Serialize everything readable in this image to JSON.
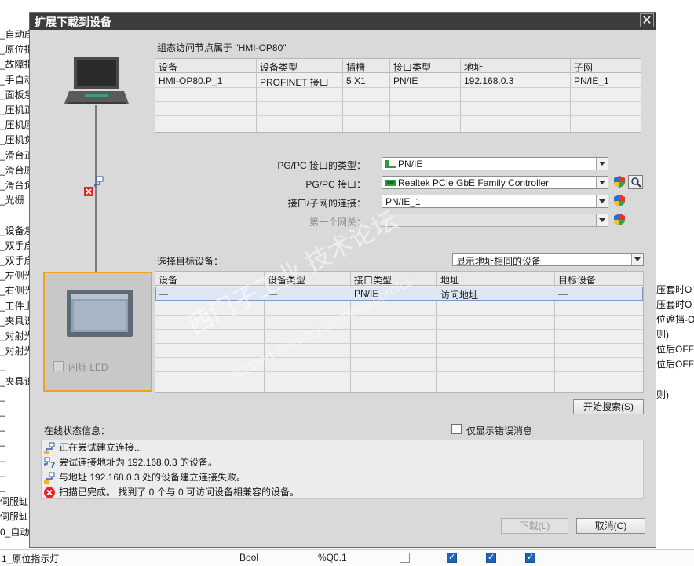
{
  "background": {
    "left_items": [
      "_自动启",
      "_原位指",
      "_故障指",
      "_手自动",
      "_面板急",
      "_压机正",
      "_压机原",
      "_压机负",
      "_滑台正",
      "_滑台原",
      "_滑台负",
      "_光栅",
      "",
      "_设备急",
      "_双手启",
      "_双手启",
      "_左侧光",
      "_右侧光",
      "_工件上",
      "_夹具识",
      "_对射光",
      "_对射光",
      "_",
      "_夹具识",
      "_",
      "_",
      "_",
      "_",
      "_",
      "_",
      "_",
      "伺服缸",
      "伺服缸",
      "0_自动"
    ],
    "right_items": [
      "压套时O",
      "压套时O",
      "位遮挡-O",
      "则)",
      "位后OFF",
      "位后OFF",
      "则)"
    ],
    "bottom_row": {
      "name": "1_原位指示灯",
      "type": "Bool",
      "address": "%Q0.1",
      "checks": [
        false,
        true,
        true,
        true
      ]
    }
  },
  "dialog": {
    "title": "扩展下载到设备",
    "close_glyph": "✕",
    "node_caption": "组态访问节点属于 \"HMI-OP80\"",
    "node_table": {
      "headers": [
        "设备",
        "设备类型",
        "插槽",
        "接口类型",
        "地址",
        "子网"
      ],
      "rows": [
        [
          "HMI-OP80.P_1",
          "PROFINET 接口",
          "5 X1",
          "PN/IE",
          "192.168.0.3",
          "PN/IE_1"
        ]
      ]
    },
    "pgpc_type": {
      "label": "PG/PC 接口的类型：",
      "value": "PN/IE"
    },
    "pgpc_iface": {
      "label": "PG/PC 接口：",
      "value": "Realtek PCIe GbE Family Controller"
    },
    "subnet_conn": {
      "label": "接口/子网的连接：",
      "value": "PN/IE_1"
    },
    "first_gateway": {
      "label": "第一个网关：",
      "value": ""
    },
    "target_label": "选择目标设备：",
    "target_filter": "显示地址相同的设备",
    "target_table": {
      "headers": [
        "设备",
        "设备类型",
        "接口类型",
        "地址",
        "目标设备"
      ],
      "rows": [
        [
          "—",
          "—",
          "PN/IE",
          "访问地址",
          "—"
        ]
      ]
    },
    "flash_led_label": "闪烁 LED",
    "start_search": "开始搜索(S)",
    "status_label": "在线状态信息：",
    "errors_only_label": "仅显示错误消息",
    "status_messages": [
      {
        "icon": "connection-icon",
        "text": "正在尝试建立连接..."
      },
      {
        "icon": "connection-question-icon",
        "text": "尝试连接地址为 192.168.0.3 的设备。"
      },
      {
        "icon": "connection-icon",
        "text": "与地址 192.168.0.3 处的设备建立连接失败。"
      },
      {
        "icon": "error-icon",
        "text": "扫描已完成。 找到了 0 个与 0 可访问设备相兼容的设备。"
      }
    ],
    "download_button": "下载(L)",
    "cancel_button": "取消(C)"
  },
  "watermark": {
    "line1": "西门子工业 技术论坛",
    "line2": "support.industry.siemens.com/cs"
  },
  "colors": {
    "title_bar": "#3d3d3d",
    "highlight_border": "#f2a11e",
    "selected_row": "#dfe6f3",
    "error": "#e0262c"
  }
}
